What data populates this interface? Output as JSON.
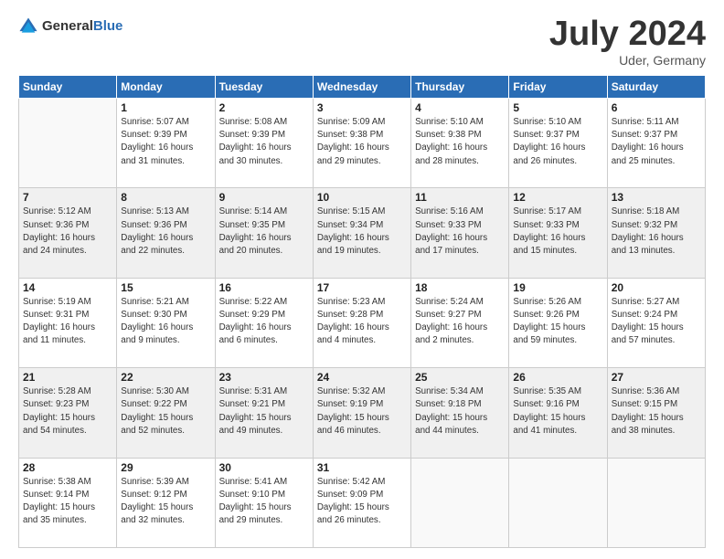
{
  "logo": {
    "text_general": "General",
    "text_blue": "Blue"
  },
  "header": {
    "month": "July 2024",
    "location": "Uder, Germany"
  },
  "days_of_week": [
    "Sunday",
    "Monday",
    "Tuesday",
    "Wednesday",
    "Thursday",
    "Friday",
    "Saturday"
  ],
  "weeks": [
    [
      {
        "day": "",
        "info": ""
      },
      {
        "day": "1",
        "info": "Sunrise: 5:07 AM\nSunset: 9:39 PM\nDaylight: 16 hours\nand 31 minutes."
      },
      {
        "day": "2",
        "info": "Sunrise: 5:08 AM\nSunset: 9:39 PM\nDaylight: 16 hours\nand 30 minutes."
      },
      {
        "day": "3",
        "info": "Sunrise: 5:09 AM\nSunset: 9:38 PM\nDaylight: 16 hours\nand 29 minutes."
      },
      {
        "day": "4",
        "info": "Sunrise: 5:10 AM\nSunset: 9:38 PM\nDaylight: 16 hours\nand 28 minutes."
      },
      {
        "day": "5",
        "info": "Sunrise: 5:10 AM\nSunset: 9:37 PM\nDaylight: 16 hours\nand 26 minutes."
      },
      {
        "day": "6",
        "info": "Sunrise: 5:11 AM\nSunset: 9:37 PM\nDaylight: 16 hours\nand 25 minutes."
      }
    ],
    [
      {
        "day": "7",
        "info": "Sunrise: 5:12 AM\nSunset: 9:36 PM\nDaylight: 16 hours\nand 24 minutes."
      },
      {
        "day": "8",
        "info": "Sunrise: 5:13 AM\nSunset: 9:36 PM\nDaylight: 16 hours\nand 22 minutes."
      },
      {
        "day": "9",
        "info": "Sunrise: 5:14 AM\nSunset: 9:35 PM\nDaylight: 16 hours\nand 20 minutes."
      },
      {
        "day": "10",
        "info": "Sunrise: 5:15 AM\nSunset: 9:34 PM\nDaylight: 16 hours\nand 19 minutes."
      },
      {
        "day": "11",
        "info": "Sunrise: 5:16 AM\nSunset: 9:33 PM\nDaylight: 16 hours\nand 17 minutes."
      },
      {
        "day": "12",
        "info": "Sunrise: 5:17 AM\nSunset: 9:33 PM\nDaylight: 16 hours\nand 15 minutes."
      },
      {
        "day": "13",
        "info": "Sunrise: 5:18 AM\nSunset: 9:32 PM\nDaylight: 16 hours\nand 13 minutes."
      }
    ],
    [
      {
        "day": "14",
        "info": "Sunrise: 5:19 AM\nSunset: 9:31 PM\nDaylight: 16 hours\nand 11 minutes."
      },
      {
        "day": "15",
        "info": "Sunrise: 5:21 AM\nSunset: 9:30 PM\nDaylight: 16 hours\nand 9 minutes."
      },
      {
        "day": "16",
        "info": "Sunrise: 5:22 AM\nSunset: 9:29 PM\nDaylight: 16 hours\nand 6 minutes."
      },
      {
        "day": "17",
        "info": "Sunrise: 5:23 AM\nSunset: 9:28 PM\nDaylight: 16 hours\nand 4 minutes."
      },
      {
        "day": "18",
        "info": "Sunrise: 5:24 AM\nSunset: 9:27 PM\nDaylight: 16 hours\nand 2 minutes."
      },
      {
        "day": "19",
        "info": "Sunrise: 5:26 AM\nSunset: 9:26 PM\nDaylight: 15 hours\nand 59 minutes."
      },
      {
        "day": "20",
        "info": "Sunrise: 5:27 AM\nSunset: 9:24 PM\nDaylight: 15 hours\nand 57 minutes."
      }
    ],
    [
      {
        "day": "21",
        "info": "Sunrise: 5:28 AM\nSunset: 9:23 PM\nDaylight: 15 hours\nand 54 minutes."
      },
      {
        "day": "22",
        "info": "Sunrise: 5:30 AM\nSunset: 9:22 PM\nDaylight: 15 hours\nand 52 minutes."
      },
      {
        "day": "23",
        "info": "Sunrise: 5:31 AM\nSunset: 9:21 PM\nDaylight: 15 hours\nand 49 minutes."
      },
      {
        "day": "24",
        "info": "Sunrise: 5:32 AM\nSunset: 9:19 PM\nDaylight: 15 hours\nand 46 minutes."
      },
      {
        "day": "25",
        "info": "Sunrise: 5:34 AM\nSunset: 9:18 PM\nDaylight: 15 hours\nand 44 minutes."
      },
      {
        "day": "26",
        "info": "Sunrise: 5:35 AM\nSunset: 9:16 PM\nDaylight: 15 hours\nand 41 minutes."
      },
      {
        "day": "27",
        "info": "Sunrise: 5:36 AM\nSunset: 9:15 PM\nDaylight: 15 hours\nand 38 minutes."
      }
    ],
    [
      {
        "day": "28",
        "info": "Sunrise: 5:38 AM\nSunset: 9:14 PM\nDaylight: 15 hours\nand 35 minutes."
      },
      {
        "day": "29",
        "info": "Sunrise: 5:39 AM\nSunset: 9:12 PM\nDaylight: 15 hours\nand 32 minutes."
      },
      {
        "day": "30",
        "info": "Sunrise: 5:41 AM\nSunset: 9:10 PM\nDaylight: 15 hours\nand 29 minutes."
      },
      {
        "day": "31",
        "info": "Sunrise: 5:42 AM\nSunset: 9:09 PM\nDaylight: 15 hours\nand 26 minutes."
      },
      {
        "day": "",
        "info": ""
      },
      {
        "day": "",
        "info": ""
      },
      {
        "day": "",
        "info": ""
      }
    ]
  ]
}
